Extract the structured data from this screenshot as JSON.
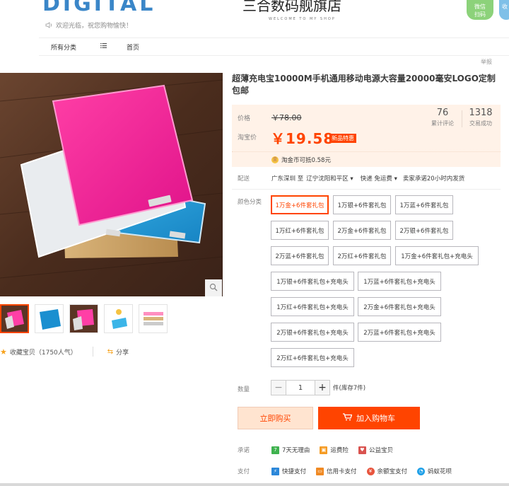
{
  "header": {
    "logo_text": "DIGITAL",
    "welcome": "欢迎光临，祝您购物愉快！",
    "shop_name": "三合数码舰旗店",
    "shop_subtitle": "WELCOME TO MY SHOP",
    "btn1": "微信\n扫码",
    "btn2": "收"
  },
  "nav": {
    "all": "所有分类",
    "home": "首页"
  },
  "report": "举报",
  "product": {
    "title": "超薄充电宝10000M手机通用移动电源大容量20000毫安LOGO定制包邮",
    "price_label": "价格",
    "old_price": "￥78.00",
    "taobao_label": "淘宝价",
    "new_price": "￥19.58",
    "promo_badge": "新品特惠",
    "reviews_count": "76",
    "reviews_label": "累计评论",
    "sales_count": "1318",
    "sales_label": "交易成功",
    "coin_text": "淘金币可抵",
    "coin_amount": "0.58元"
  },
  "shipping": {
    "label": "配送",
    "from": "广东深圳 至",
    "to": "辽宁沈阳和平区",
    "express": "快递 免运费",
    "promise": "卖家承诺20小时内发货"
  },
  "color": {
    "label": "颜色分类",
    "options": [
      "1万金+6件套礼包",
      "1万银+6件套礼包",
      "1万蓝+6件套礼包",
      "1万红+6件套礼包",
      "2万金+6件套礼包",
      "2万银+6件套礼包",
      "2万蓝+6件套礼包",
      "2万红+6件套礼包",
      "1万金+6件套礼包+充电头",
      "1万银+6件套礼包+充电头",
      "1万蓝+6件套礼包+充电头",
      "1万红+6件套礼包+充电头",
      "2万金+6件套礼包+充电头",
      "2万银+6件套礼包+充电头",
      "2万蓝+6件套礼包+充电头",
      "2万红+6件套礼包+充电头"
    ],
    "selected_index": 0
  },
  "quantity": {
    "label": "数量",
    "value": "1",
    "stock": "件(库存7件)",
    "minus": "−",
    "plus": "+"
  },
  "actions": {
    "buy_now": "立即购买",
    "add_to_cart": "加入购物车"
  },
  "promise": {
    "label": "承诺",
    "items": [
      "7天无理由",
      "运费险",
      "公益宝贝"
    ]
  },
  "payment": {
    "label": "支付",
    "items": [
      "快捷支付",
      "信用卡支付",
      "余额宝支付",
      "蚂蚁花呗"
    ]
  },
  "favorites": {
    "text": "收藏宝贝（1750人气）",
    "share": "分享"
  },
  "colors": {
    "accent": "#ff4400",
    "price_bg": "#fff2e8",
    "brand_blue": "#3a86c8"
  }
}
